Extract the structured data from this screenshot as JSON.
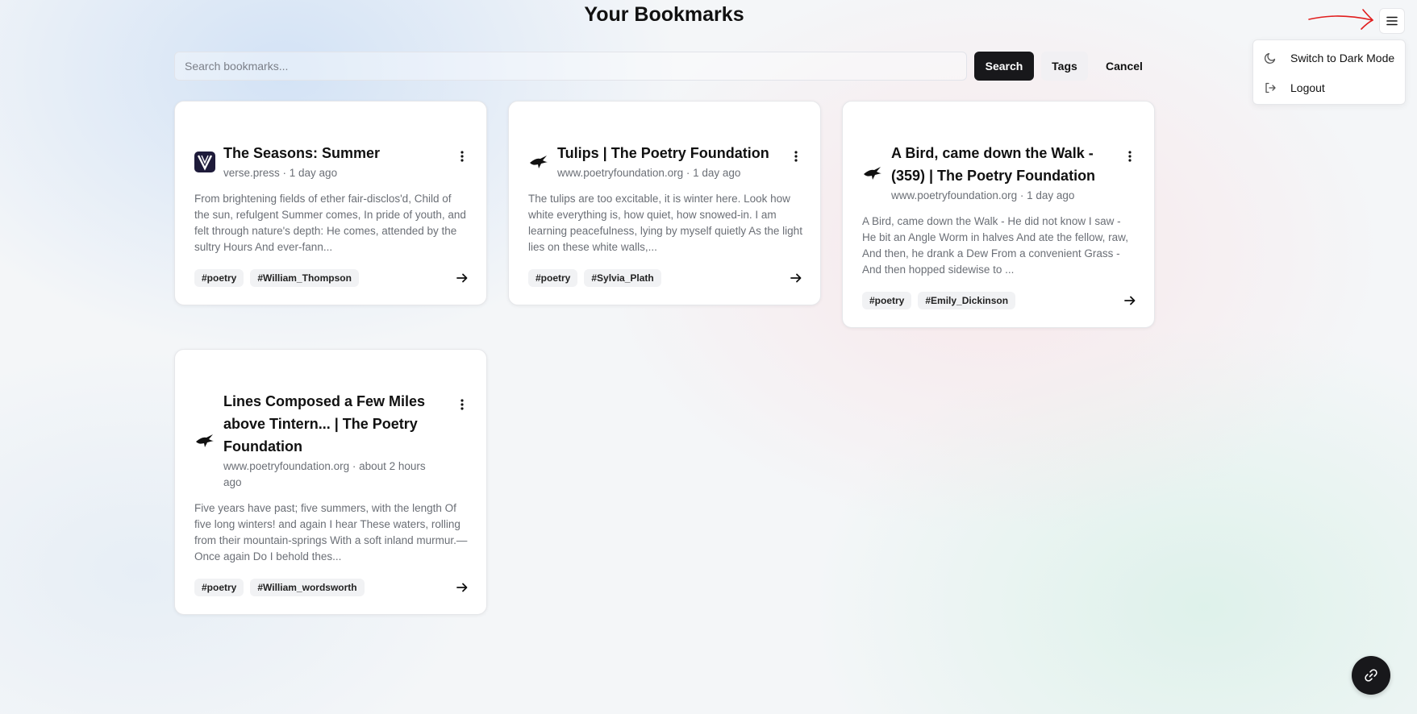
{
  "page": {
    "title": "Your Bookmarks"
  },
  "search": {
    "placeholder": "Search bookmarks...",
    "value": "",
    "search_label": "Search",
    "tags_label": "Tags",
    "cancel_label": "Cancel"
  },
  "menu": {
    "items": [
      {
        "label": "Switch to Dark Mode",
        "icon": "moon-icon"
      },
      {
        "label": "Logout",
        "icon": "logout-icon"
      }
    ]
  },
  "bookmarks": [
    {
      "title": "The Seasons: Summer",
      "meta": "verse.press · 1 day ago",
      "favicon": "verse-press-logo",
      "excerpt": "From brightening fields of ether fair-disclos'd, Child of the sun, refulgent Summer comes, In pride of youth, and felt through nature's depth: He comes, attended by the sultry Hours And ever-fann...",
      "tags": [
        "#poetry",
        "#William_Thompson"
      ]
    },
    {
      "title": "Tulips | The Poetry Foundation",
      "meta": "www.poetryfoundation.org · 1 day ago",
      "favicon": "poetry-foundation-bird-logo",
      "excerpt": "The tulips are too excitable, it is winter here. Look how white everything is, how quiet, how snowed-in. I am learning peacefulness, lying by myself quietly As the light lies on these white walls,...",
      "tags": [
        "#poetry",
        "#Sylvia_Plath"
      ]
    },
    {
      "title": "A Bird, came down the Walk - (359) | The Poetry Foundation",
      "meta": "www.poetryfoundation.org · 1 day ago",
      "favicon": "poetry-foundation-bird-logo",
      "excerpt": "A Bird, came down the Walk - He did not know I saw - He bit an Angle Worm in halves And ate the fellow, raw, And then, he drank a Dew From a convenient Grass - And then hopped sidewise to ...",
      "tags": [
        "#poetry",
        "#Emily_Dickinson"
      ]
    },
    {
      "title": "Lines Composed a Few Miles above Tintern... | The Poetry Foundation",
      "meta": "www.poetryfoundation.org · about 2 hours ago",
      "favicon": "poetry-foundation-bird-logo",
      "excerpt": "Five years have past; five summers, with the length Of five long winters! and again I hear These waters, rolling from their mountain-springs With a soft inland murmur.—Once again Do I behold thes...",
      "tags": [
        "#poetry",
        "#William_wordsworth"
      ]
    }
  ],
  "icons": {
    "menu_toggle": "hamburger-icon",
    "card_menu": "more-vertical-icon",
    "card_open": "arrow-right-icon",
    "fab": "link-icon"
  },
  "colors": {
    "primary": "#18181b",
    "annotation": "#e11d1d"
  }
}
